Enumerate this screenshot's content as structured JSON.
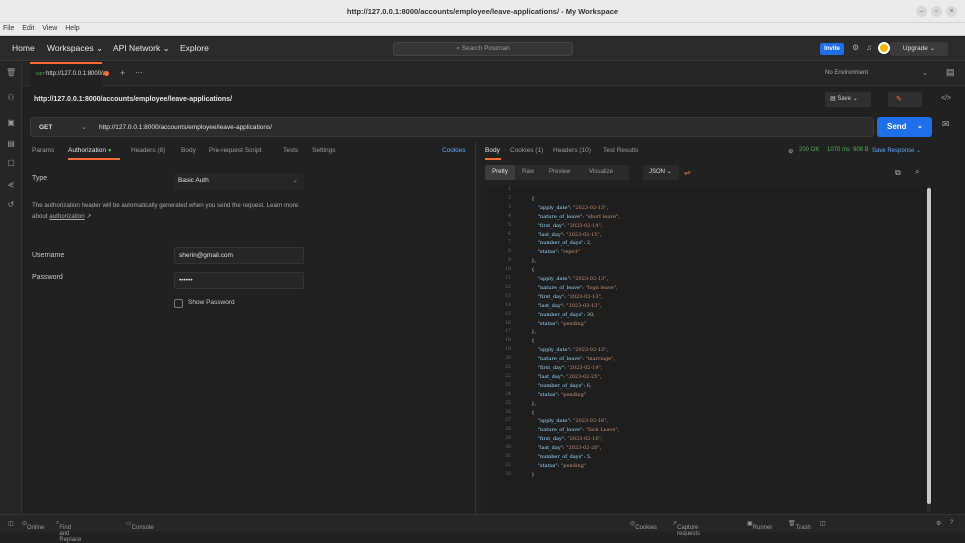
{
  "window": {
    "title": "http://127.0.0.1:8000/accounts/employee/leave-applications/ - My Workspace"
  },
  "menu": [
    "File",
    "Edit",
    "View",
    "Help"
  ],
  "topnav": {
    "home": "Home",
    "workspaces": "Workspaces",
    "api_network": "API Network",
    "explore": "Explore",
    "search_placeholder": "Search Postman",
    "invite": "Invite",
    "upgrade": "Upgrade"
  },
  "tab": {
    "label": "http://127.0.0.1:8000/a",
    "method_badge": "GET"
  },
  "environment": "No Environment",
  "request": {
    "title": "http://127.0.0.1:8000/accounts/employee/leave-applications/",
    "method": "GET",
    "url": "http://127.0.0.1:8000/accounts/employee/leave-applications/",
    "save": "Save",
    "send": "Send"
  },
  "req_tabs": [
    "Params",
    "Authorization",
    "Headers (8)",
    "Body",
    "Pre-request Script",
    "Tests",
    "Settings"
  ],
  "cookies_link": "Cookies",
  "auth": {
    "type_label": "Type",
    "type_value": "Basic Auth",
    "note": "The authorization header will be automatically generated when you send the request. Learn more about",
    "note_link": "authorization",
    "username_label": "Username",
    "username_value": "sherin@gmail.com",
    "password_label": "Password",
    "password_value": "••••••",
    "show_password": "Show Password"
  },
  "resp_tabs": [
    "Body",
    "Cookies (1)",
    "Headers (10)",
    "Test Results"
  ],
  "status": {
    "code": "200 OK",
    "time": "1070 ms",
    "size": "908 B",
    "save_response": "Save Response"
  },
  "view_tabs": [
    "Pretty",
    "Raw",
    "Preview",
    "Visualize"
  ],
  "format": "JSON",
  "code_lines": [
    {
      "n": "1",
      "t": ""
    },
    {
      "n": "2",
      "t": "    {"
    },
    {
      "n": "3",
      "t": "        \"apply_date\": \"2023-02-13\","
    },
    {
      "n": "4",
      "t": "        \"nature_of_leave\": \"short leave\","
    },
    {
      "n": "5",
      "t": "        \"first_day\": \"2023-02-14\","
    },
    {
      "n": "6",
      "t": "        \"last_day\": \"2023-02-15\","
    },
    {
      "n": "7",
      "t": "        \"number_of_days\": 2,"
    },
    {
      "n": "8",
      "t": "        \"status\": \"reject\""
    },
    {
      "n": "9",
      "t": "    },"
    },
    {
      "n": "10",
      "t": "    {"
    },
    {
      "n": "11",
      "t": "        \"apply_date\": \"2023-02-13\","
    },
    {
      "n": "12",
      "t": "        \"nature_of_leave\": \"logn leave\","
    },
    {
      "n": "13",
      "t": "        \"first_day\": \"2023-02-13\","
    },
    {
      "n": "14",
      "t": "        \"last_day\": \"2023-03-13\","
    },
    {
      "n": "15",
      "t": "        \"number_of_days\": 30,"
    },
    {
      "n": "16",
      "t": "        \"status\": \"pending\""
    },
    {
      "n": "17",
      "t": "    },"
    },
    {
      "n": "18",
      "t": "    {"
    },
    {
      "n": "19",
      "t": "        \"apply_date\": \"2023-02-13\","
    },
    {
      "n": "20",
      "t": "        \"nature_of_leave\": \"marriage\","
    },
    {
      "n": "21",
      "t": "        \"first_day\": \"2023-02-19\","
    },
    {
      "n": "22",
      "t": "        \"last_day\": \"2023-02-25\","
    },
    {
      "n": "23",
      "t": "        \"number_of_days\": 6,"
    },
    {
      "n": "24",
      "t": "        \"status\": \"pending\""
    },
    {
      "n": "25",
      "t": "    },"
    },
    {
      "n": "26",
      "t": "    {"
    },
    {
      "n": "27",
      "t": "        \"apply_date\": \"2023-02-16\","
    },
    {
      "n": "28",
      "t": "        \"nature_of_leave\": \"Sick Leave\","
    },
    {
      "n": "29",
      "t": "        \"first_day\": \"2023-02-16\","
    },
    {
      "n": "30",
      "t": "        \"last_day\": \"2023-02-20\","
    },
    {
      "n": "31",
      "t": "        \"number_of_days\": 5,"
    },
    {
      "n": "32",
      "t": "        \"status\": \"pending\""
    },
    {
      "n": "33",
      "t": "    }"
    }
  ],
  "statusbar": {
    "online": "Online",
    "find_replace": "Find and Replace",
    "console": "Console",
    "cookies": "Cookies",
    "capture": "Capture requests",
    "runner": "Runner",
    "trash": "Trash"
  },
  "colors": {
    "accent": "#ff6c37",
    "primary": "#1f6feb",
    "ok": "#4caf50"
  }
}
